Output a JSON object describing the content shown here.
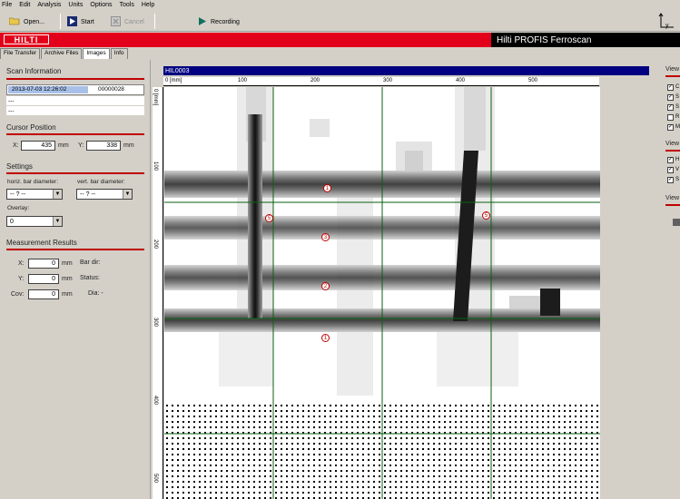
{
  "menu": [
    "File",
    "Edit",
    "Analysis",
    "Units",
    "Options",
    "Tools",
    "Help"
  ],
  "toolbar": {
    "open_label": "Open...",
    "start_label": "Start",
    "cancel_label": "Cancel",
    "recording_label": "Recording",
    "axis_y": "y"
  },
  "brand": {
    "logo": "HILTI",
    "product": "Hilti PROFIS Ferroscan"
  },
  "tabs": [
    "File Transfer",
    "Archive Files",
    "Images",
    "Info"
  ],
  "scan_info": {
    "title": "Scan Information",
    "date": "2013-07-03 12:26:02",
    "id": "00000028",
    "row2": "---",
    "row3": "---"
  },
  "cursor": {
    "title": "Cursor Position",
    "x_label": "X:",
    "x": "435",
    "y_label": "Y:",
    "y": "338",
    "unit": "mm"
  },
  "settings": {
    "title": "Settings",
    "horz_label": "horiz. bar diameter:",
    "horz_value": "-- ? --",
    "vert_label": "vert. bar diameter:",
    "vert_value": "-- ? --",
    "overlay_label": "Overlay:",
    "overlay_value": "0"
  },
  "measurement": {
    "title": "Measurement Results",
    "x_label": "X:",
    "x": "0",
    "y_label": "Y:",
    "y": "0",
    "cov_label": "Cov:",
    "cov": "0",
    "unit": "mm",
    "bar_dir": "Bar dir:",
    "status": "Status:",
    "diam": "Dia: -"
  },
  "viewer": {
    "title": "HIL0003",
    "x_unit": "0 [mm]",
    "y_unit": "0 [mm]",
    "x_ticks": [
      "100",
      "200",
      "300",
      "400",
      "500"
    ],
    "y_ticks": [
      "100",
      "200",
      "300",
      "400",
      "500"
    ]
  },
  "markers": [
    "1",
    "3",
    "2",
    "1",
    "5",
    "5"
  ],
  "right_panel": {
    "view1": "View",
    "view1_checks": [
      "C",
      "S",
      "S",
      "R",
      "M"
    ],
    "view1_states": [
      true,
      true,
      true,
      false,
      true
    ],
    "view2": "View",
    "view2_checks": [
      "H",
      "V",
      "S"
    ],
    "view2_states": [
      true,
      true,
      true
    ],
    "view3": "View"
  }
}
